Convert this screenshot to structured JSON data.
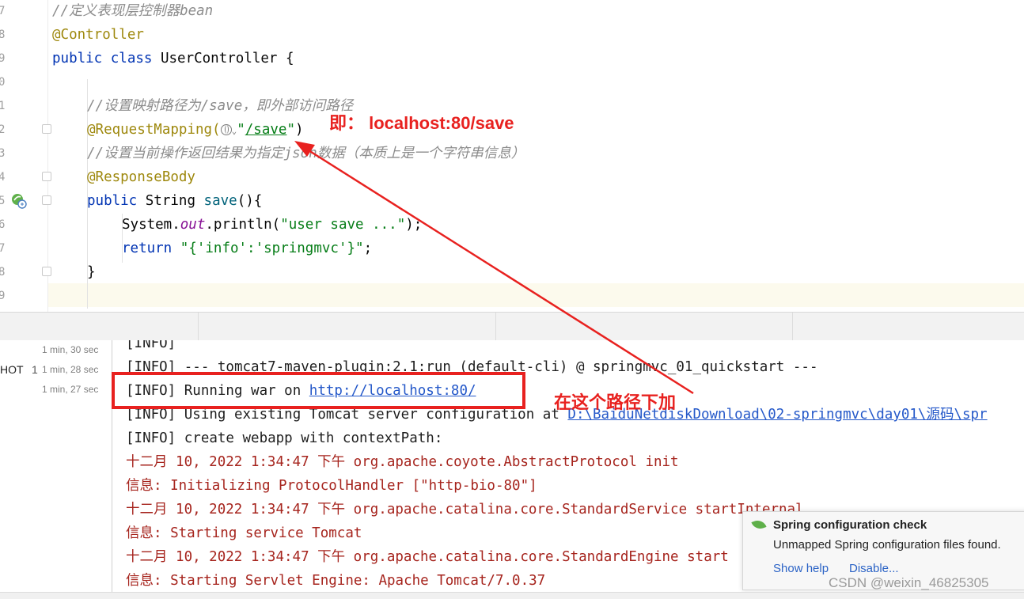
{
  "editor": {
    "line_numbers": [
      "7",
      "8",
      "9",
      "0",
      "1",
      "2",
      "3",
      "4",
      "5",
      "6",
      "7",
      "8",
      "9"
    ],
    "code": {
      "l1": "//定义表现层控制器bean",
      "l2": "@Controller",
      "l3_kw": "public class ",
      "l3_name": "UserController {",
      "l5": "//设置映射路径为/save，即外部访问路径",
      "l6_an": "@RequestMapping(",
      "l6_q1": "\"",
      "l6_str": "/save",
      "l6_q2": "\"",
      "l6_end": ")",
      "l7": "//设置当前操作返回结果为指定json数据（本质上是一个字符串信息）",
      "l8": "@ResponseBody",
      "l9_kw": "public ",
      "l9_type": "String ",
      "l9_m": "save",
      "l9_end": "(){",
      "l10_a": "System.",
      "l10_f": "out",
      "l10_b": ".println(",
      "l10_s": "\"user save ...\"",
      "l10_c": ");",
      "l11_kw": "return ",
      "l11_s": "\"{'info':'springmvc'}\"",
      "l11_c": ";",
      "l12": "}"
    }
  },
  "console": {
    "timestamps": [
      "1 min, 30 sec",
      "1 min, 28 sec",
      "1 min, 27 sec"
    ],
    "left_label": "HOT",
    "left_num": "1",
    "lines": {
      "c1": "[INFO]",
      "c2": "[INFO] --- tomcat7-maven-plugin:2.1:run (default-cli) @ springmvc_01_quickstart ---",
      "c3_a": "[INFO] Running war on ",
      "c3_link": "http://localhost:80/",
      "c4_a": "[INFO] Using existing Tomcat server configuration at ",
      "c4_link": "D:\\BaiduNetdiskDownload\\02-springmvc\\day01\\源码\\spr",
      "c5": "[INFO] create webapp with contextPath:",
      "c6": "十二月 10, 2022 1:34:47 下午 org.apache.coyote.AbstractProtocol init",
      "c7": "信息: Initializing ProtocolHandler [\"http-bio-80\"]",
      "c8": "十二月 10, 2022 1:34:47 下午 org.apache.catalina.core.StandardService startInternal",
      "c9": "信息: Starting service Tomcat",
      "c10": "十二月 10, 2022 1:34:47 下午 org.apache.catalina.core.StandardEngine start",
      "c11": "信息: Starting Servlet Engine: Apache Tomcat/7.0.37"
    }
  },
  "annotations": {
    "top": "即： localhost:80/save",
    "bottom": "在这个路径下加"
  },
  "notification": {
    "title": "Spring configuration check",
    "body": "Unmapped Spring configuration files found.",
    "show_help": "Show help",
    "disable": "Disable..."
  },
  "watermark": "CSDN @weixin_46825305",
  "colors": {
    "annotation_red": "#e8211f",
    "keyword": "#0033b3",
    "annotation": "#9e880d",
    "string": "#067d17",
    "link": "#2458c9"
  }
}
